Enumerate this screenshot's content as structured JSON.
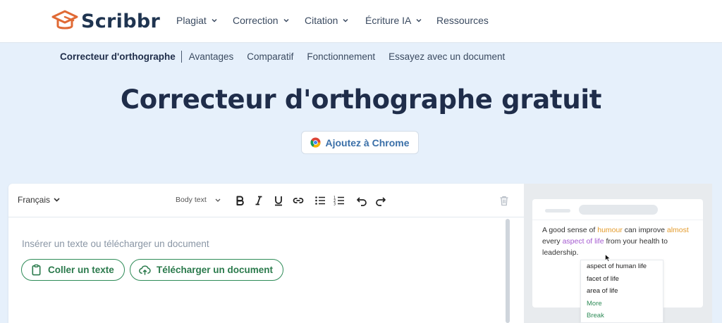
{
  "brand": {
    "name": "Scribbr",
    "accent": "#e06a35",
    "dark": "#1f3450"
  },
  "nav": {
    "items": [
      {
        "label": "Plagiat",
        "has_dropdown": true
      },
      {
        "label": "Correction",
        "has_dropdown": true
      },
      {
        "label": "Citation",
        "has_dropdown": true
      },
      {
        "label": "Écriture IA",
        "has_dropdown": true
      },
      {
        "label": "Ressources",
        "has_dropdown": false
      }
    ]
  },
  "subnav": {
    "active": "Correcteur d'orthographe",
    "links": [
      "Avantages",
      "Comparatif",
      "Fonctionnement",
      "Essayez avec un document"
    ]
  },
  "page": {
    "title": "Correcteur d'orthographe gratuit",
    "chrome_button": "Ajoutez à Chrome"
  },
  "editor": {
    "language": "Français",
    "text_style": "Body text",
    "placeholder": "Insérer un texte ou télécharger un document",
    "paste_button": "Coller un texte",
    "upload_button": "Télécharger un document"
  },
  "preview": {
    "text_parts": [
      {
        "text": "A good sense of ",
        "style": "normal"
      },
      {
        "text": "humour",
        "style": "orange"
      },
      {
        "text": " can improve ",
        "style": "normal"
      },
      {
        "text": "almost",
        "style": "orange"
      },
      {
        "text": " every ",
        "style": "normal"
      },
      {
        "text": "aspect of life",
        "style": "purple"
      },
      {
        "text": " from your health to leadership.",
        "style": "normal"
      }
    ],
    "suggestions": [
      "aspect of human life",
      "facet of life",
      "area of life"
    ],
    "more_label": "More",
    "break_label": "Break"
  }
}
